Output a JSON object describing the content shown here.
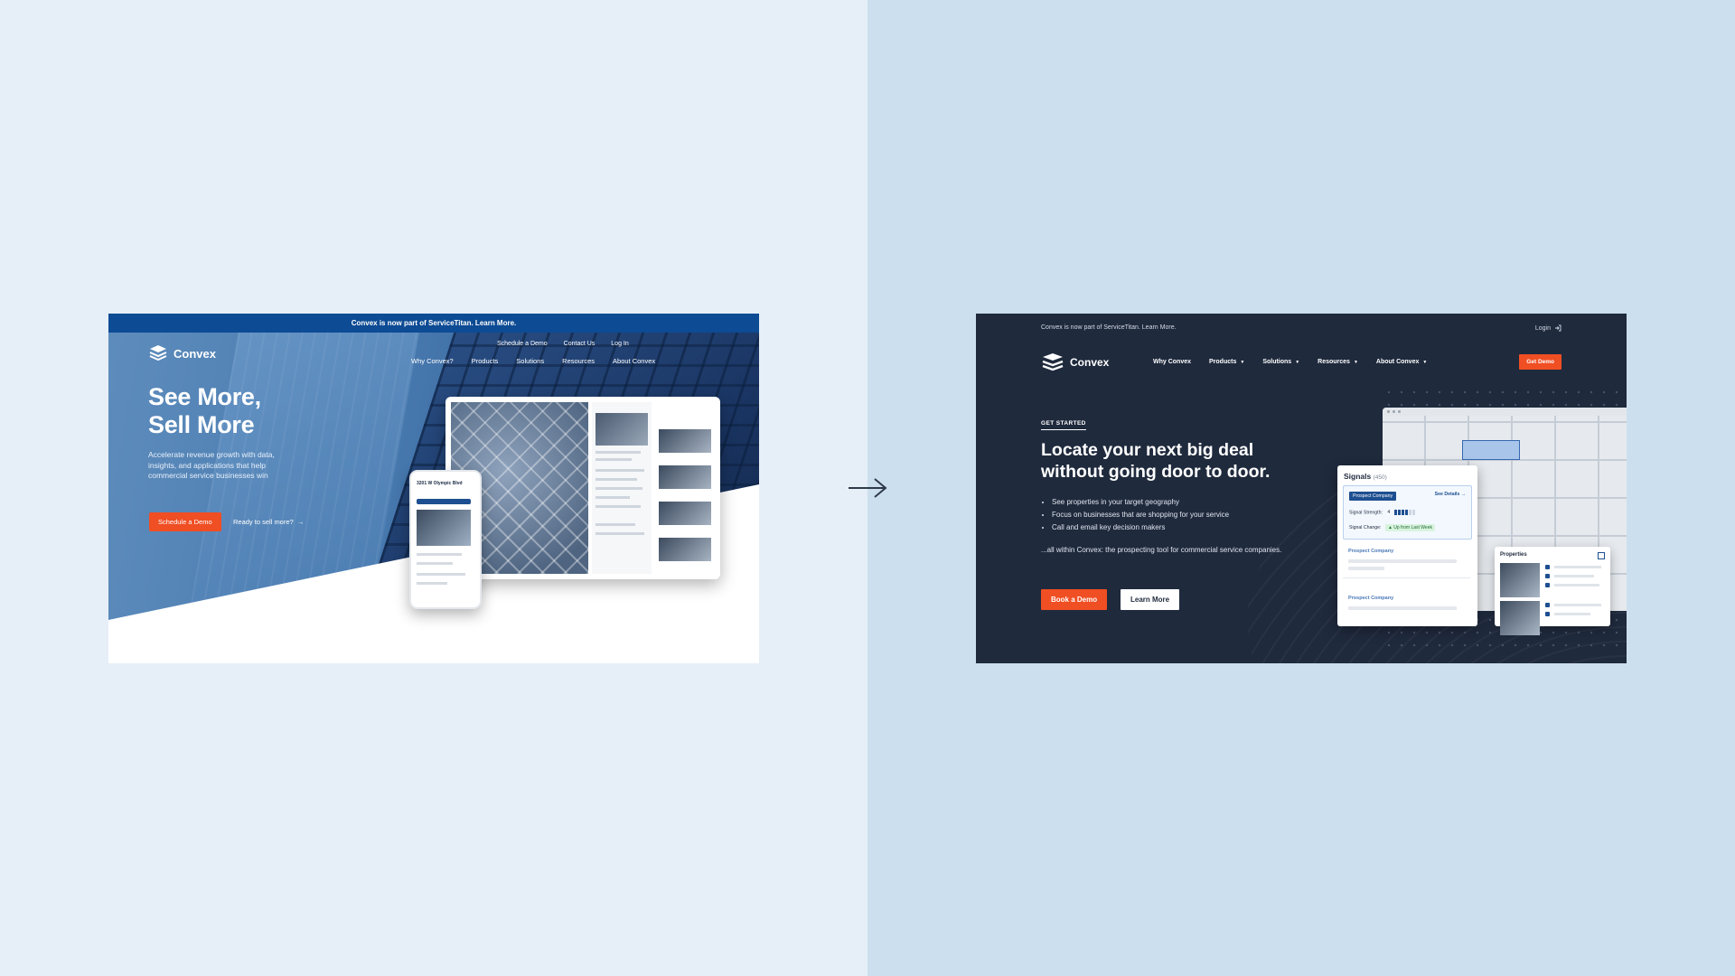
{
  "before": {
    "announcement": "Convex is now part of ServiceTitan. Learn More.",
    "logo_text": "Convex",
    "top_links": [
      "Schedule a Demo",
      "Contact Us",
      "Log In"
    ],
    "nav": [
      "Why Convex?",
      "Products",
      "Solutions",
      "Resources",
      "About Convex"
    ],
    "headline_1": "See More,",
    "headline_2": "Sell More",
    "subtext": "Accelerate revenue growth with data, insights, and applications that help commercial service businesses win",
    "cta_primary": "Schedule a Demo",
    "cta_secondary": "Ready to sell more?",
    "phone_title": "3201 W Olympic Blvd"
  },
  "after": {
    "announcement": "Convex is now part of ServiceTitan. Learn More.",
    "login": "Login",
    "logo_text": "Convex",
    "nav": [
      {
        "label": "Why Convex"
      },
      {
        "label": "Products"
      },
      {
        "label": "Solutions"
      },
      {
        "label": "Resources"
      },
      {
        "label": "About Convex"
      }
    ],
    "get_demo": "Get Demo",
    "eyebrow": "GET STARTED",
    "headline": "Locate your next big deal without going door to door.",
    "bullets": [
      "See properties in your target geography",
      "Focus on businesses that are shopping for your service",
      "Call and email key decision makers"
    ],
    "body": "...all within Convex: the prospecting tool for commercial service companies.",
    "book_demo": "Book a Demo",
    "learn_more": "Learn More",
    "signals": {
      "title": "Signals",
      "count": "(450)",
      "prospect_label": "Prospect Company",
      "see_details": "See Details",
      "strength_label": "Signal Strength:",
      "strength_value": "4",
      "strength_level": 4,
      "strength_max": 6,
      "change_label": "Signal Change:",
      "change_value": "Up from Last Week",
      "more_prospects": [
        "Prospect Company",
        "Prospect Company"
      ]
    },
    "properties_title": "Properties"
  },
  "colors": {
    "accent_orange": "#f04e23",
    "before_banner": "#0d4b94",
    "after_bg": "#1f2a3d",
    "brand_blue": "#1d4f91"
  }
}
